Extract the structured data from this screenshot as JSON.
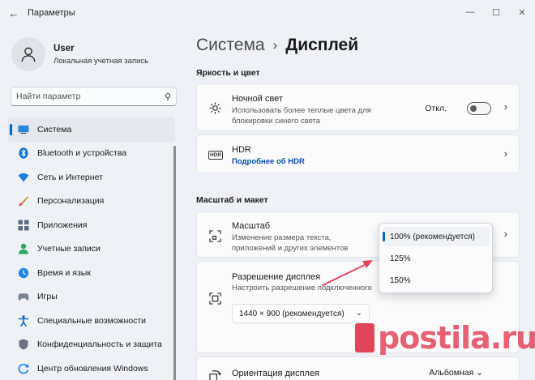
{
  "window": {
    "title": "Параметры",
    "back_icon": "←",
    "minimize_icon": "—",
    "maximize_icon": "☐",
    "close_icon": "✕"
  },
  "profile": {
    "name": "User",
    "account_type": "Локальная учетная запись"
  },
  "search": {
    "placeholder": "Найти параметр",
    "icon": "⚲"
  },
  "nav": [
    {
      "label": "Система",
      "active": true
    },
    {
      "label": "Bluetooth и устройства"
    },
    {
      "label": "Сеть и Интернет"
    },
    {
      "label": "Персонализация"
    },
    {
      "label": "Приложения"
    },
    {
      "label": "Учетные записи"
    },
    {
      "label": "Время и язык"
    },
    {
      "label": "Игры"
    },
    {
      "label": "Специальные возможности"
    },
    {
      "label": "Конфиденциальность и защита"
    },
    {
      "label": "Центр обновления Windows"
    }
  ],
  "breadcrumb": {
    "parent": "Система",
    "separator": "›",
    "current": "Дисплей"
  },
  "sections": {
    "brightness": "Яркость и цвет",
    "scale_layout": "Масштаб и макет"
  },
  "night_light": {
    "title": "Ночной свет",
    "subtitle_1": "Использовать более теплые цвета для",
    "subtitle_2": "блокировки синего света",
    "state": "Откл.",
    "chevron": "›"
  },
  "hdr": {
    "title": "HDR",
    "link": "Подробнее об HDR",
    "chevron": "›",
    "icon_text": "HDR"
  },
  "scale": {
    "title": "Масштаб",
    "subtitle_1": "Изменение размера текста,",
    "subtitle_2": "приложений и других элементов",
    "chevron": "›",
    "options": [
      {
        "label": "100% (рекомендуется)",
        "selected": true
      },
      {
        "label": "125%"
      },
      {
        "label": "150%"
      }
    ]
  },
  "resolution": {
    "title": "Разрешение дисплея",
    "subtitle": "Настроить разрешение подключенного",
    "value": "1440 × 900 (рекомендуется)",
    "dropdown_icon": "⌄"
  },
  "orientation": {
    "title": "Ориентация дисплея",
    "value": "Альбомная",
    "dropdown_icon": "⌄"
  },
  "colors": {
    "accent": "#0067c0",
    "arrow": "#e0455a",
    "watermark": "#e0455a"
  },
  "watermark": {
    "text": "postila.ru"
  }
}
